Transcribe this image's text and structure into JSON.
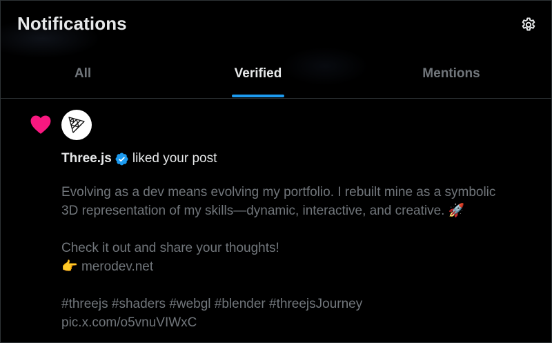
{
  "header": {
    "title": "Notifications",
    "settings_icon": "gear-icon"
  },
  "tabs": [
    {
      "label": "All",
      "active": false
    },
    {
      "label": "Verified",
      "active": true
    },
    {
      "label": "Mentions",
      "active": false
    }
  ],
  "colors": {
    "accent": "#1d9bf0",
    "like": "#f91880",
    "text_primary": "#e7e9ea",
    "text_secondary": "#71767b"
  },
  "notification": {
    "type_icon": "heart-icon",
    "actor_avatar": "threejs-logo",
    "actor_name": "Three.js",
    "verified_badge": "verified-badge-icon",
    "action_text": "liked your post",
    "post": {
      "line1": "Evolving as a dev means evolving my portfolio. I rebuilt mine as a symbolic",
      "line2": "3D representation of my skills—dynamic, interactive, and creative.",
      "rocket_emoji": "🚀",
      "line3": "Check it out and share your thoughts!",
      "pointing_emoji": "👉",
      "link": "merodev.net",
      "hashtags": "#threejs #shaders #webgl #blender #threejsJourney",
      "media_link": "pic.x.com/o5vnuVIWxC"
    }
  }
}
